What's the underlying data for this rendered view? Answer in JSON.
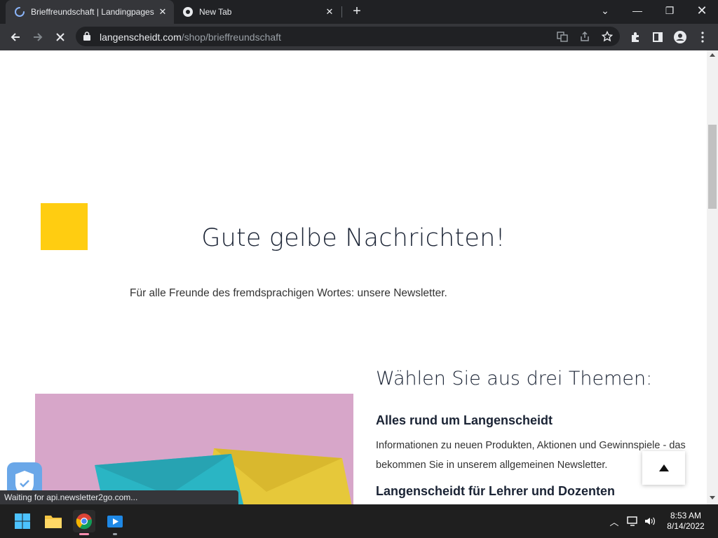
{
  "browser": {
    "tabs": [
      {
        "title": "Brieffreundschaft | Landingpages",
        "state": "loading"
      },
      {
        "title": "New Tab",
        "state": "idle"
      }
    ],
    "url": {
      "domain": "langenscheidt.com",
      "path": "/shop/brieffreundschaft"
    },
    "status_text": "Waiting for api.newsletter2go.com..."
  },
  "page": {
    "headline": "Gute gelbe Nachrichten!",
    "subline": "Für alle Freunde des fremdsprachigen Wortes: unsere Newsletter.",
    "themes_title": "Wählen Sie aus drei Themen:",
    "themes": [
      {
        "heading": "Alles rund um Langenscheidt",
        "text": "Informationen zu neuen Produkten, Aktionen und Gewinnspiele - das bekommen Sie in unserem allgemeinen Newsletter."
      },
      {
        "heading": "Langenscheidt für Lehrer und Dozenten",
        "text": ""
      }
    ],
    "accent_color": "#ffcd11"
  },
  "taskbar": {
    "time": "8:53 AM",
    "date": "8/14/2022"
  }
}
